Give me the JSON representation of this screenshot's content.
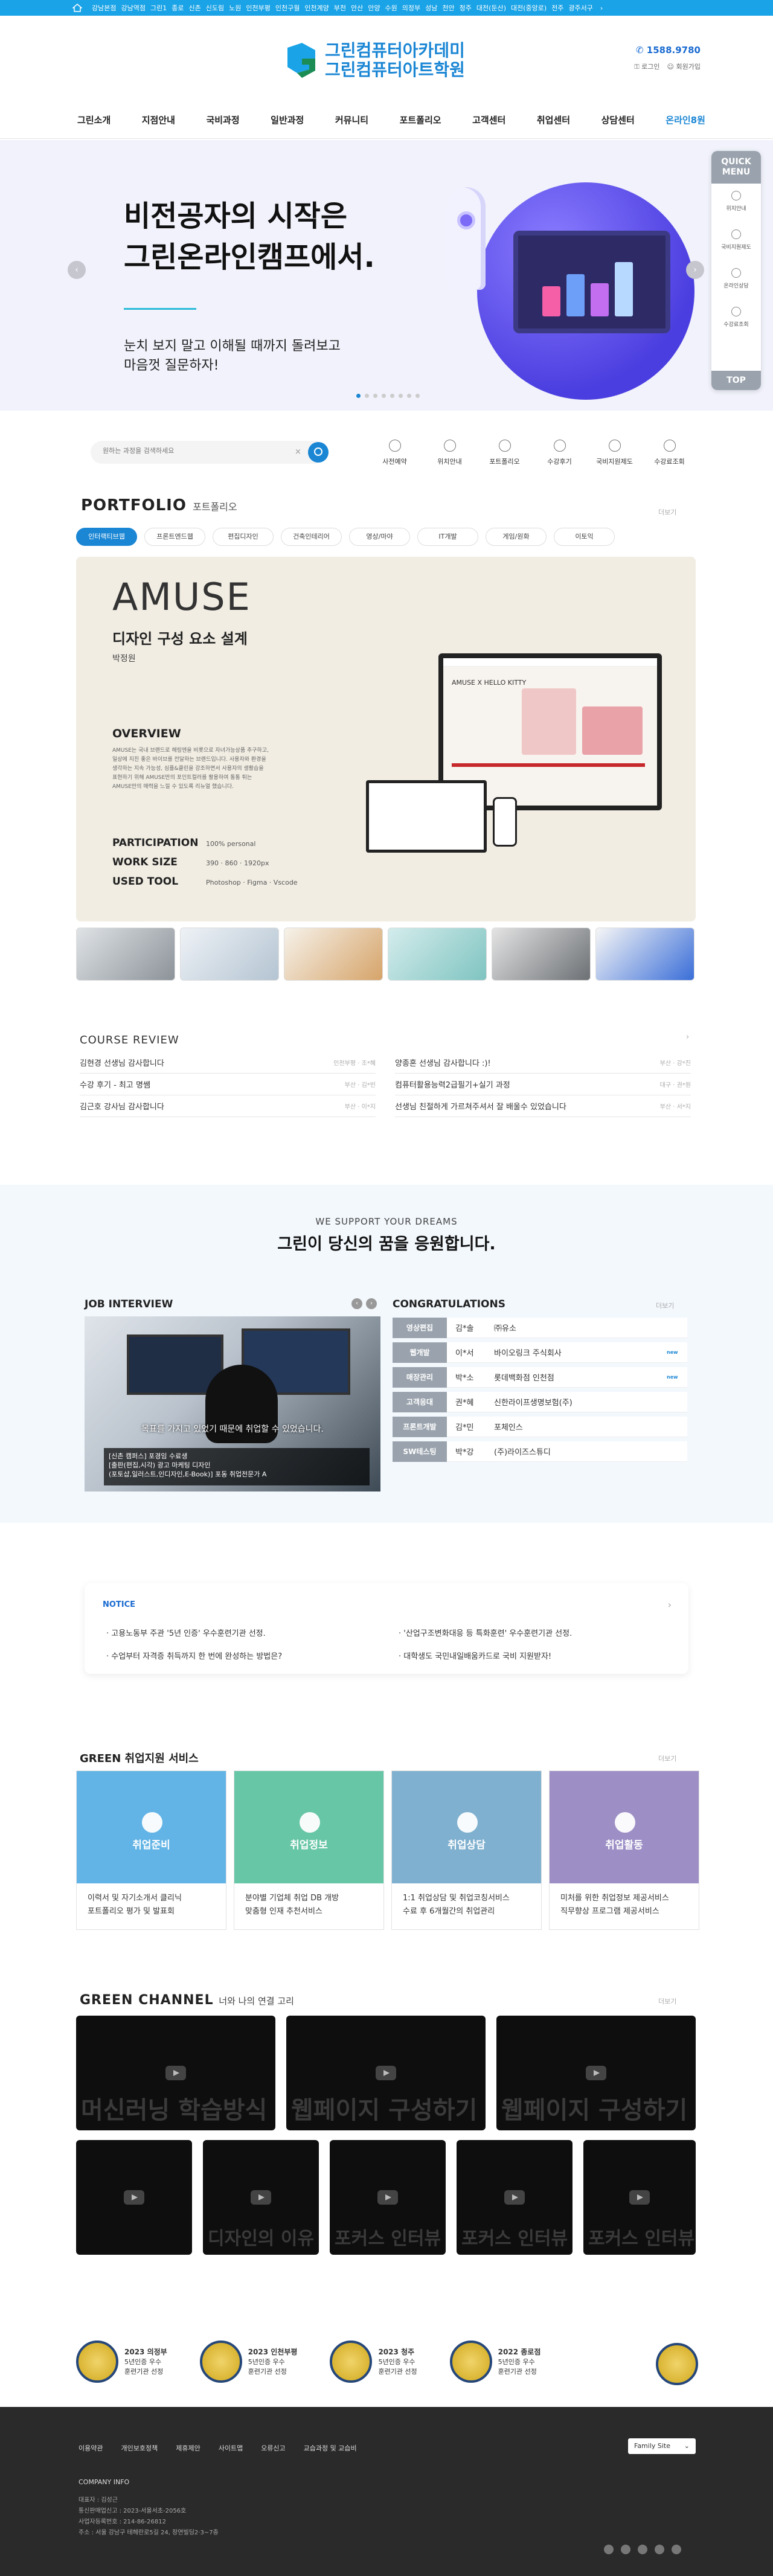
{
  "topbar": {
    "branches": [
      "강남본점",
      "강남역점",
      "그린1",
      "종로",
      "신촌",
      "신도림",
      "노원",
      "인천부평",
      "인천구월",
      "인천계양",
      "부천",
      "안산",
      "안양",
      "수원",
      "의정부",
      "성남",
      "천안",
      "청주",
      "대전(둔산)",
      "대전(중앙로)",
      "전주",
      "광주서구"
    ]
  },
  "header": {
    "logo_line1": "그린컴퓨터아카데미",
    "logo_line2": "그린컴퓨터아트학원",
    "phone": "1588.9780",
    "login": "로그인",
    "join": "회원가입"
  },
  "nav": [
    "그린소개",
    "지점안내",
    "국비과정",
    "일반과정",
    "커뮤니티",
    "포트폴리오",
    "고객센터",
    "취업센터",
    "상담센터",
    "온라인8원"
  ],
  "hero": {
    "title_line1": "비전공자의 시작은",
    "title_line2": "그린온라인캠프에서.",
    "desc_line1": "눈치 보지 말고 이해될 때까지 돌려보고",
    "desc_line2": "마음껏 질문하자!",
    "prev": "‹",
    "next": "›"
  },
  "quick_menu": {
    "title_line1": "QUICK",
    "title_line2": "MENU",
    "items": [
      "위치안내",
      "국비지원제도",
      "온라인상담",
      "수강료조회"
    ],
    "top": "TOP"
  },
  "search": {
    "placeholder": "원하는 과정을 검색하세요",
    "clear": "×"
  },
  "quick_links": [
    "사전예약",
    "위치안내",
    "포트폴리오",
    "수강후기",
    "국비지원제도",
    "수강료조회"
  ],
  "portfolio": {
    "title": "PORTFOLIO",
    "subtitle": "포트폴리오",
    "more": "더보기",
    "tabs": [
      "인터랙티브웹",
      "프론트엔드웹",
      "편집디자인",
      "건축인테리어",
      "영상/마야",
      "IT개발",
      "게임/원화",
      "이토익"
    ],
    "featured": {
      "brand": "AMUSE",
      "heading": "디자인 구성 요소 설계",
      "author": "박정원",
      "overview_label": "OVERVIEW",
      "overview_text": "AMUSE는 국내 브랜드로 헤링엔을 비롯으로 자녀가능상품 추구하고, 일상에 지친 좋은 바이브를 전달하는 브랜드입니다. 사용자와 환경을 생각하는 지속 가능성, 심플&클린을 강조하면서 사용자의 생활습을 표현하기 위해 AMUSE만의 포인트컬러를 활용하여 통통 튀는 AMUSE만의 매력을 느낄 수 있도록 리뉴얼 했습니다.",
      "participation_label": "PARTICIPATION",
      "participation_value": "100% personal",
      "work_size_label": "WORK SIZE",
      "work_size_value": "390 · 860 · 1920px",
      "used_tool_label": "USED TOOL",
      "used_tool_value": "Photoshop · Figma · Vscode",
      "mock_title": "AMUSE X HELLO KITTY"
    }
  },
  "review": {
    "title": "COURSE REVIEW",
    "items": [
      {
        "text": "김현경 선생님 감사합니다",
        "meta": "인천부평 · 조*혜"
      },
      {
        "text": "양종혼 선생님 감사합니다 :)!",
        "meta": "부산 · 강*진"
      },
      {
        "text": "수강 후기 - 최고 명쌤",
        "meta": "부산 · 김*빈"
      },
      {
        "text": "컴퓨터활용능력2급필기+실기 과정",
        "meta": "대구 · 권*원"
      },
      {
        "text": "김근호 강사님 감사합니다",
        "meta": "부산 · 이*지"
      },
      {
        "text": "선생님 친절하게 가르쳐주셔서 잘 배울수 있었습니다",
        "meta": "부산 · 서*지"
      }
    ]
  },
  "dream": {
    "sub": "WE SUPPORT YOUR DREAMS",
    "title": "그린이 당신의 꿈을 응원합니다."
  },
  "job_interview": {
    "title": "JOB INTERVIEW",
    "caption": "목표를 가지고 있었기 때문에 취업할 수 있었습니다.",
    "detail_line1": "[신촌 캠퍼스] 포경임 수료생",
    "detail_line2": "[출판(편집,시각) 광고 마케팅 디자인",
    "detail_line3": "(포토샵,일러스트,인디자인,E-Book)] 포동 취업전문가 A"
  },
  "congrats": {
    "title": "CONGRATULATIONS",
    "more": "더보기",
    "items": [
      {
        "tag": "영상편집",
        "name": "김*솔",
        "company": "㈜유소",
        "new": ""
      },
      {
        "tag": "웹개발",
        "name": "이*서",
        "company": "바이오링크 주식회사",
        "new": "new"
      },
      {
        "tag": "매장관리",
        "name": "박*소",
        "company": "롯데백화점 인천점",
        "new": "new"
      },
      {
        "tag": "고객응대",
        "name": "권*혜",
        "company": "신한라이프생명보험(주)",
        "new": ""
      },
      {
        "tag": "프론트개발",
        "name": "김*민",
        "company": "포체인스",
        "new": ""
      },
      {
        "tag": "SW테스팅",
        "name": "박*강",
        "company": "(주)라이즈스튜디",
        "new": ""
      }
    ]
  },
  "notice": {
    "title": "NOTICE",
    "items": [
      "고용노동부 주관 '5년 인증' 우수훈련기관 선정.",
      "'산업구조변화대응 등 특화훈련' 우수훈련기관 선정.",
      "수업부터 자격증 취득까지 한 번에 완성하는 방법은?",
      "대학생도 국민내일배움카드로 국비 지원받자!"
    ]
  },
  "job_services": {
    "title": "GREEN 취업지원 서비스",
    "more": "더보기",
    "cards": [
      {
        "label": "취업준비",
        "color": "#62b4e6",
        "line1": "이력서 및 자기소개서 클리닉",
        "line2": "포트폴리오 평가 및 발표회"
      },
      {
        "label": "취업정보",
        "color": "#67c6a6",
        "line1": "분야별 기업체 취업 DB 개방",
        "line2": "맞춤형 인재 추천서비스"
      },
      {
        "label": "취업상담",
        "color": "#7fb0cf",
        "line1": "1:1 취업상담 및 취업코칭서비스",
        "line2": "수료 후 6개월간의 취업관리"
      },
      {
        "label": "취업활동",
        "color": "#9d8fc6",
        "line1": "미처를 위한 취업정보 제공서비스",
        "line2": "직무향상 프로그램 제공서비스"
      }
    ]
  },
  "channel": {
    "title": "GREEN CHANNEL",
    "subtitle": "너와 나의 연결 고리",
    "more": "더보기",
    "videos": [
      "머신러닝 학습방식",
      "웹페이지 구성하기",
      "웹페이지 구성하기",
      "",
      "디자인의 이유",
      "포커스 인터뷰",
      "포커스 인터뷰",
      "포커스 인터뷰"
    ]
  },
  "awards": [
    {
      "year": "2023 의정부",
      "line1": "5년인증 우수",
      "line2": "훈련기관 선정"
    },
    {
      "year": "2023 인천부평",
      "line1": "5년인증 우수",
      "line2": "훈련기관 선정"
    },
    {
      "year": "2023 청주",
      "line1": "5년인증 우수",
      "line2": "훈련기관 선정"
    },
    {
      "year": "2022 종로점",
      "line1": "5년인증 우수",
      "line2": "훈련기관 선정"
    }
  ],
  "footer": {
    "links": [
      "이용약관",
      "개인보호정책",
      "제휴제안",
      "사이트맵",
      "오류신고",
      "교습과정 및 교습비"
    ],
    "family_site": "Family Site",
    "company_info": "COMPANY INFO",
    "info_lines": [
      "대표자 : 김성근",
      "통신판매업신고 : 2023-서울서초-2056호",
      "사업자등록번호 : 214-86-26812",
      "주소 : 서울 강남구 테헤란로5길 24, 장연빌딩2·3~7층"
    ]
  },
  "colors": {
    "primary": "#1a86d4",
    "topbar": "#1aa3e6",
    "footer": "#2a2a2a"
  }
}
